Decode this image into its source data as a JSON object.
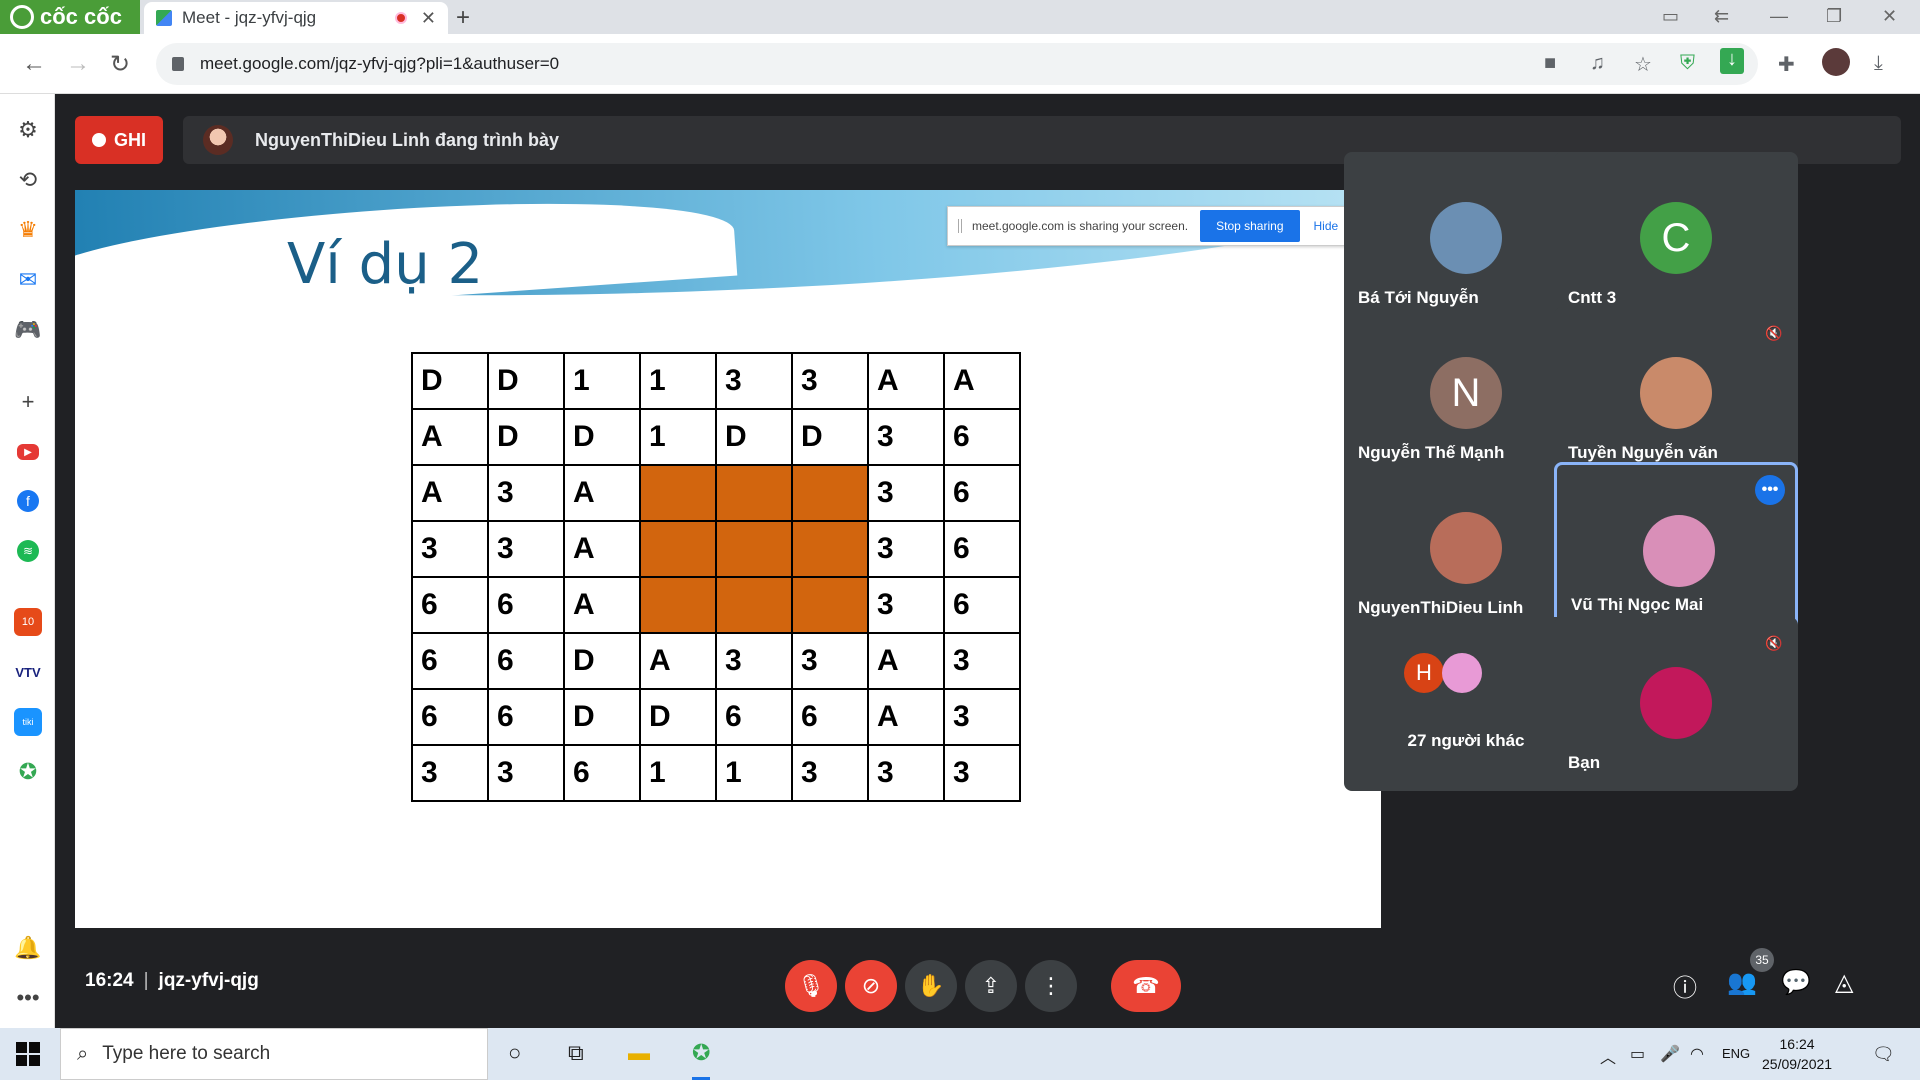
{
  "browser": {
    "brand": "cốc cốc",
    "tab_title": "Meet - jqz-yfvj-qjg",
    "url": "meet.google.com/jqz-yfvj-qjg?pli=1&authuser=0"
  },
  "meet": {
    "rec_label": "GHI",
    "presenter_text": "NguyenThiDieu Linh đang trình bày",
    "time": "16:24",
    "meeting_code": "jqz-yfvj-qjg",
    "people_count": "35"
  },
  "slide": {
    "title": "Ví dụ 2",
    "share_notice": {
      "text": "meet.google.com is sharing your screen.",
      "stop_label": "Stop sharing",
      "hide_label": "Hide"
    },
    "grid": [
      [
        "D",
        "D",
        "1",
        "1",
        "3",
        "3",
        "A",
        "A"
      ],
      [
        "A",
        "D",
        "D",
        "1",
        "D",
        "D",
        "3",
        "6"
      ],
      [
        "A",
        "3",
        "A",
        "",
        "",
        "",
        "3",
        "6"
      ],
      [
        "3",
        "3",
        "A",
        "",
        "",
        "",
        "3",
        "6"
      ],
      [
        "6",
        "6",
        "A",
        "",
        "",
        "",
        "3",
        "6"
      ],
      [
        "6",
        "6",
        "D",
        "A",
        "3",
        "3",
        "A",
        "3"
      ],
      [
        "6",
        "6",
        "D",
        "D",
        "6",
        "6",
        "A",
        "3"
      ],
      [
        "3",
        "3",
        "6",
        "1",
        "1",
        "3",
        "3",
        "3"
      ]
    ],
    "highlight_color": "#d2650e"
  },
  "participants": [
    {
      "name": "Bá Tới Nguyễn",
      "initial": "",
      "muted": true,
      "color": "#6b8fb3"
    },
    {
      "name": "Cntt 3",
      "initial": "C",
      "muted": false,
      "color": "#43a047"
    },
    {
      "name": "Nguyễn Thế Mạnh",
      "initial": "N",
      "muted": true,
      "color": "#8d6e63"
    },
    {
      "name": "Tuyền Nguyễn văn",
      "initial": "",
      "muted": true,
      "color": "#c98a6a"
    },
    {
      "name": "NguyenThiDieu Linh",
      "initial": "",
      "muted": false,
      "color": "#b86d5a"
    },
    {
      "name": "Vũ Thị Ngọc Mai",
      "initial": "",
      "muted": false,
      "color": "#d98fb8"
    },
    {
      "name": "27 người khác",
      "initial": "H",
      "muted": false,
      "color": "#d84315"
    },
    {
      "name": "Bạn",
      "initial": "",
      "muted": true,
      "color": "#c2185b"
    }
  ],
  "taskbar": {
    "search_placeholder": "Type here to search",
    "lang": "ENG",
    "time": "16:24",
    "date": "25/09/2021"
  },
  "icons": [
    "settings-icon",
    "history-icon",
    "crown-icon",
    "messenger-icon",
    "gamepad-icon",
    "plus-icon",
    "youtube-icon",
    "facebook-icon",
    "spotify-icon",
    "shopee-icon",
    "vtv-icon",
    "tiki-icon",
    "coccoc-icon",
    "bell-icon",
    "more-icon"
  ]
}
